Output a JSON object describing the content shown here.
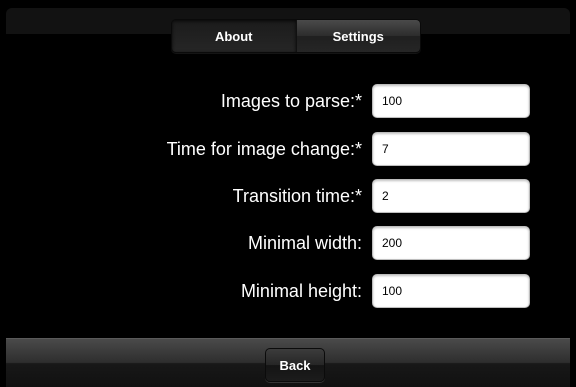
{
  "tabs": {
    "about": "About",
    "settings": "Settings"
  },
  "fields": [
    {
      "label": "Images to parse:*",
      "value": "100"
    },
    {
      "label": "Time for image change:*",
      "value": "7"
    },
    {
      "label": "Transition time:*",
      "value": "2"
    },
    {
      "label": "Minimal width:",
      "value": "200"
    },
    {
      "label": "Minimal height:",
      "value": "100"
    }
  ],
  "toolbar": {
    "back_label": "Back"
  },
  "colors": {
    "background": "#000000",
    "input_background": "#ffffff",
    "label_text": "#ffffff"
  }
}
